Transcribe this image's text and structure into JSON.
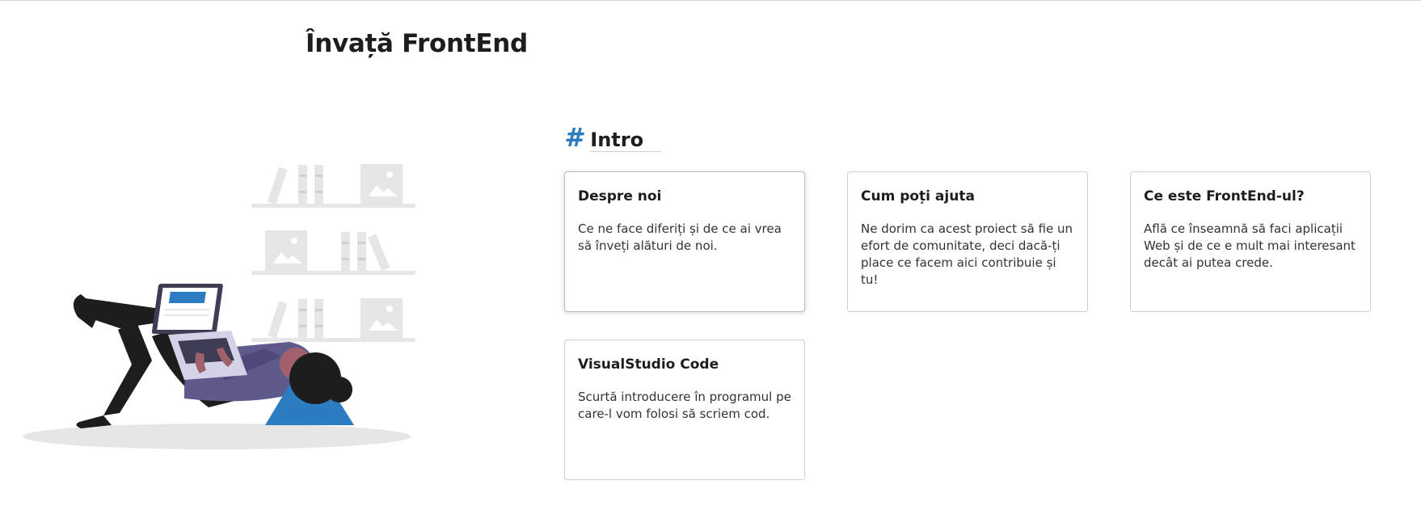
{
  "site": {
    "title": "Învață FrontEnd"
  },
  "section": {
    "hash": "#",
    "title": "Intro"
  },
  "cards": [
    {
      "title": "Despre noi",
      "description": "Ce ne face diferiți și de ce ai vrea să înveți alături de noi."
    },
    {
      "title": "Cum poți ajuta",
      "description": "Ne dorim ca acest proiect să fie un efort de comunitate, deci dacă-ți place ce facem aici contribuie și tu!"
    },
    {
      "title": "Ce este FrontEnd-ul?",
      "description": "Află ce înseamnă să faci aplicații Web și de ce e mult mai interesant decât ai putea crede."
    },
    {
      "title": "VisualStudio Code",
      "description": "Scurtă introducere în programul pe care-l vom folosi să scriem cod."
    }
  ],
  "colors": {
    "accent": "#2b7cc0",
    "border": "#cfcfcf",
    "text": "#1d1d1d"
  },
  "illustration": {
    "icon": "person-reading-laptop-illustration"
  }
}
